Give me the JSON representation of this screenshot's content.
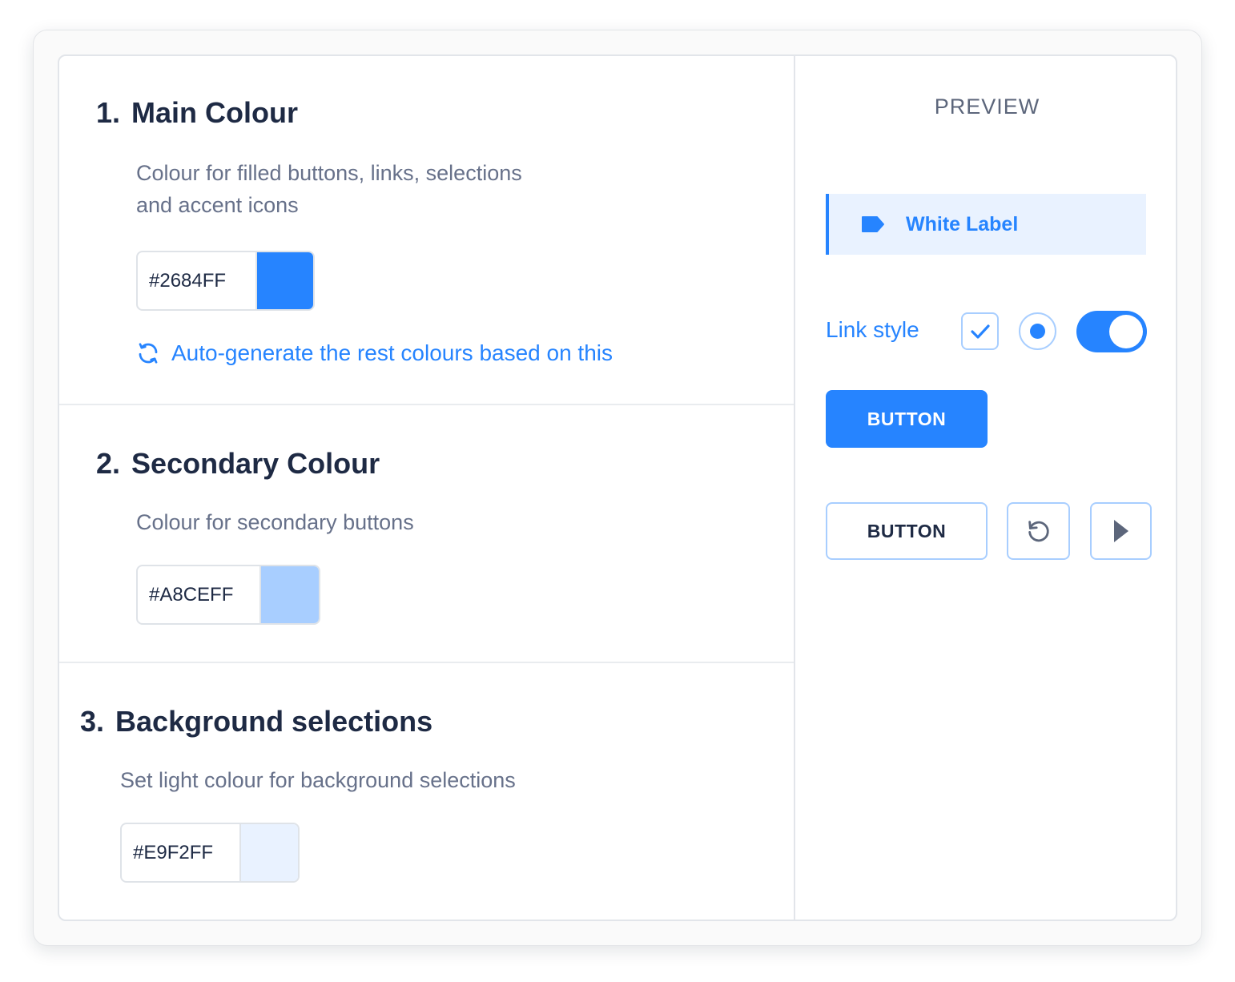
{
  "sections": [
    {
      "number": "1.",
      "title": "Main Colour",
      "description": [
        "Colour for filled buttons, links, selections",
        "and accent icons"
      ],
      "hex": "#2684FF",
      "swatch_color": "#2684FF",
      "auto_generate_label": "Auto-generate the rest colours based on this"
    },
    {
      "number": "2.",
      "title": "Secondary Colour",
      "description": [
        "Colour for secondary buttons"
      ],
      "hex": "#A8CEFF",
      "swatch_color": "#A8CEFF"
    },
    {
      "number": "3.",
      "title": "Background selections",
      "description": [
        "Set light colour for background selections"
      ],
      "hex": "#E9F2FF",
      "swatch_color": "#E9F2FF"
    }
  ],
  "preview": {
    "title": "PREVIEW",
    "nav_item_label": "White Label",
    "link_label": "Link style",
    "checkbox_checked": true,
    "radio_selected": true,
    "toggle_on": true,
    "primary_button_label": "BUTTON",
    "secondary_button_label": "BUTTON",
    "icons": [
      "tag-icon",
      "check-icon",
      "refresh-icon",
      "reset-icon",
      "play-icon"
    ]
  },
  "colors": {
    "accent": "#2684FF",
    "secondary": "#A8CEFF",
    "background_selection": "#E9F2FF"
  }
}
